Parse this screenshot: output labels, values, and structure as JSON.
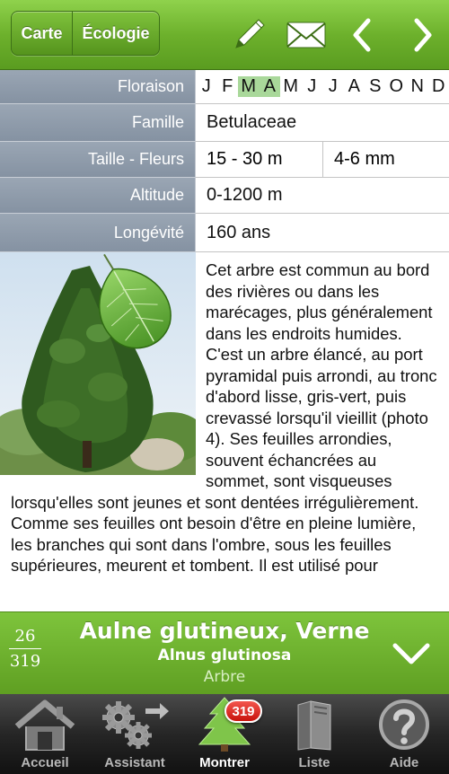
{
  "toolbar": {
    "segments": [
      "Carte",
      "Écologie"
    ],
    "icons": [
      "pencil-icon",
      "envelope-icon",
      "chevron-left-icon",
      "chevron-right-icon"
    ]
  },
  "info": {
    "floraison": {
      "label": "Floraison",
      "months": [
        "J",
        "F",
        "M",
        "A",
        "M",
        "J",
        "J",
        "A",
        "S",
        "O",
        "N",
        "D"
      ],
      "active_months": [
        2,
        3
      ]
    },
    "famille": {
      "label": "Famille",
      "value": "Betulaceae"
    },
    "taille": {
      "label": "Taille - Fleurs",
      "value": "15 - 30 m",
      "value2": "4-6 mm"
    },
    "altitude": {
      "label": "Altitude",
      "value": "0-1200 m"
    },
    "longevite": {
      "label": "Longévité",
      "value": "160 ans"
    }
  },
  "description": "Cet arbre est commun au bord des rivières ou dans les marécages, plus généralement dans les endroits humides. C'est un arbre élancé, au port pyramidal puis arrondi, au tronc d'abord lisse, gris-vert, puis crevassé lorsqu'il vieillit (photo 4). Ses feuilles arrondies, souvent échancrées au sommet, sont visqueuses lorsqu'elles sont jeunes et sont dentées irrégulièrement. Comme ses feuilles ont besoin d'être en pleine lumière, les branches qui sont dans l'ombre, sous les feuilles supérieures, meurent et tombent. Il est utilisé pour",
  "species": {
    "index": "26",
    "total": "319",
    "name": "Aulne glutineux, Verne",
    "latin": "Alnus glutinosa",
    "type": "Arbre"
  },
  "tabs": [
    {
      "label": "Accueil",
      "icon": "house-icon"
    },
    {
      "label": "Assistant",
      "icon": "gears-icon"
    },
    {
      "label": "Montrer",
      "icon": "tree-icon",
      "badge": "319",
      "active": true
    },
    {
      "label": "Liste",
      "icon": "books-icon"
    },
    {
      "label": "Aide",
      "icon": "help-icon"
    }
  ],
  "colors": {
    "toolbar_green": "#6db12c",
    "label_grey": "#8f9cab",
    "month_highlight": "#a9d89a",
    "badge_red": "#d8221a"
  }
}
